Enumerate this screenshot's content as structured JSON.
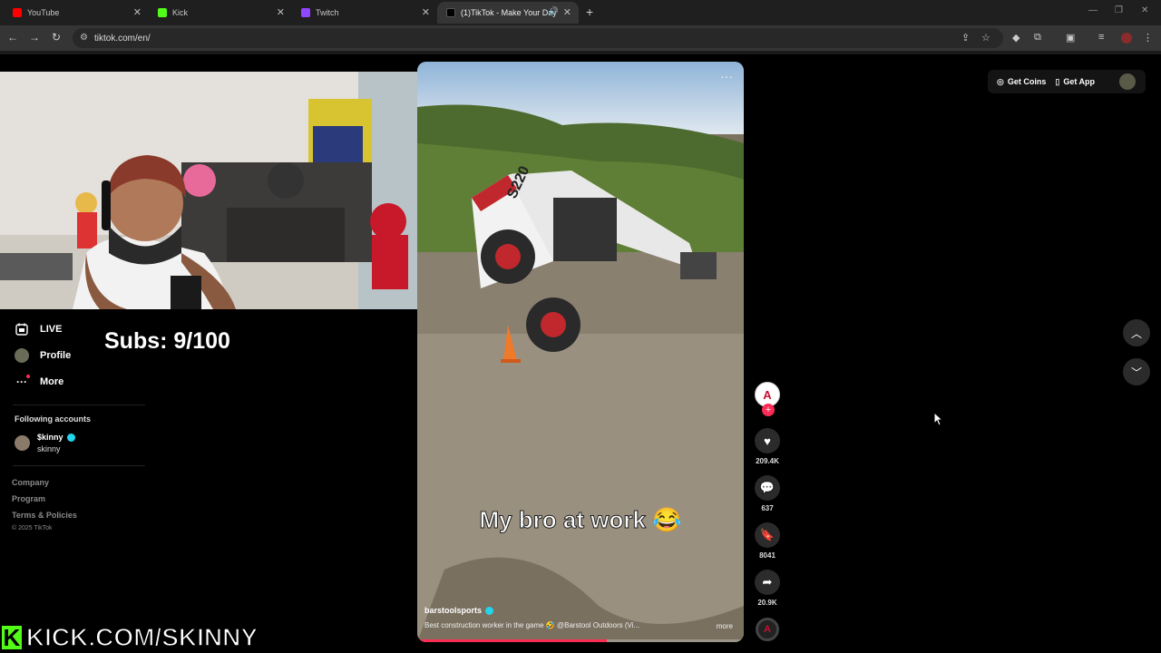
{
  "browser": {
    "tabs": [
      {
        "label": "YouTube",
        "color": "#ff0000"
      },
      {
        "label": "Kick",
        "color": "#53fc18"
      },
      {
        "label": "Twitch",
        "color": "#9146ff"
      },
      {
        "label": "(1)TikTok - Make Your Day",
        "color": "#ffffff"
      }
    ],
    "url": "tiktok.com/en/"
  },
  "overlay": {
    "subs_text": "Subs: 9/100",
    "kick_letter": "K",
    "kick_url": "KICK.COM/SKINNY"
  },
  "sidebar": {
    "items": [
      {
        "label": "LIVE",
        "icon": "live-calendar-icon"
      },
      {
        "label": "Profile",
        "icon": "profile-avatar"
      },
      {
        "label": "More",
        "icon": "more-dots-icon"
      }
    ],
    "following_header": "Following accounts",
    "following": [
      {
        "name": "$kinny",
        "username": "skinny",
        "verified": true
      }
    ],
    "footer_links": [
      "Company",
      "Program",
      "Terms & Policies"
    ],
    "copyright": "© 2025 TikTok"
  },
  "video": {
    "caption": "My bro at work 😂",
    "author": "barstoolsports",
    "description": "Best construction worker in the game 🤣 @Barstool Outdoors (Vi...",
    "more_label": "more",
    "progress": 0.58,
    "machine_label": "S220"
  },
  "actions": {
    "likes": "209.4K",
    "comments": "637",
    "saves": "8041",
    "shares": "20.9K"
  },
  "topbar": {
    "get_coins": "Get Coins",
    "get_app": "Get App"
  },
  "colors": {
    "accent": "#fe2c55",
    "kick_green": "#53fc18",
    "verified": "#20d5ec"
  }
}
